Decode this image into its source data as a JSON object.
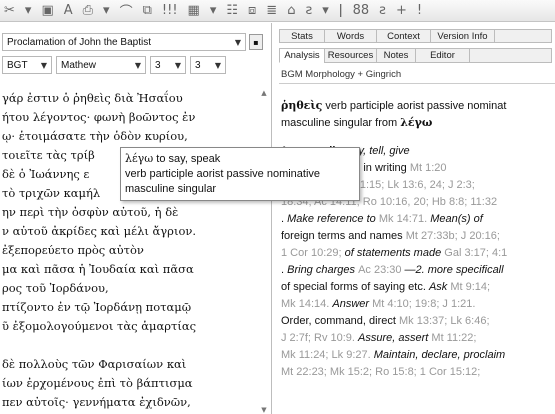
{
  "toolbar": {
    "icons": [
      "cut-icon",
      "dropdown-icon",
      "window-icon",
      "font-icon",
      "print-icon",
      "arrow-icon",
      "separator",
      "monitor-icon",
      "grid-icon",
      "columns-icon",
      "table-icon",
      "compare-icon",
      "tools-icon",
      "list-icon",
      "sep-icon",
      "plus-icon"
    ],
    "glyphs": [
      "✂",
      "▾",
      "▣",
      "A",
      "⎙",
      "▾",
      "⌒",
      "⧉",
      "!!!",
      "▦",
      "▾",
      "☷",
      "⧈",
      "≣",
      "⌂",
      "ƨ",
      "▾",
      "ǀ",
      "88",
      "ƨ",
      "+",
      "!"
    ]
  },
  "left": {
    "passage_title": "Proclamation of John the Baptist",
    "version": "BGT",
    "book": "Mathew",
    "chapter": "3",
    "verse": "3",
    "greek_lines": [
      "γάρ ἐστιν ὁ ῥηθεὶς διὰ Ἠσαΐου",
      "ήτου λέγοντος· φωνὴ βοῶντος ἐν",
      "ῳ· ἑτοιμάσατε τὴν ὁδὸν κυρίου,",
      "τοιεῖτε τὰς τρίβ",
      "δὲ ὁ Ἰωάννης ε",
      "τὸ τριχῶν καμήλ",
      "ην περὶ τὴν ὀσφὺν αὐτοῦ, ἡ δὲ",
      "ν αὐτοῦ ἀκρίδες καὶ μέλι ἄγριον.",
      "ἐξεπορεύετο πρὸς αὐτὸν",
      "μα καὶ πᾶσα ἡ Ἰουδαία καὶ πᾶσα",
      "ρος τοῦ Ἰορδάνου,",
      "πτίζοντο ἐν τῷ Ἰορδάνῃ ποταμῷ",
      "ῦ ἐξομολογούμενοι τὰς ἁμαρτίας",
      "",
      "δὲ πολλοὺς τῶν Φαρισαίων καὶ",
      "ίων ἐρχομένους ἐπὶ τὸ βάπτισμα",
      "πεν αὐτοῖς· γεννήματα ἐχιδνῶν,"
    ]
  },
  "popup": {
    "lemma": "λέγω",
    "gloss": "to say, speak",
    "parse_line1": "verb participle aorist passive nominative",
    "parse_line2": "masculine singular"
  },
  "right": {
    "tabs_row1": [
      "Stats",
      "Words",
      "Context",
      "Version Info",
      ""
    ],
    "tabs_row2": [
      "Analysis",
      "Resources",
      "Notes",
      "Editor",
      ""
    ],
    "active_tab": "Analysis",
    "resource": "BGM Morphology + Gingrich",
    "entry_word": "ῥηθεὶς",
    "entry_parse": "verb participle aorist passive nominat",
    "entry_parse2": "masculine singular from",
    "entry_lemma": "λέγω",
    "lines": [
      {
        "b": "",
        "t": "1. generally, ",
        "i": "say, tell, give",
        "r": ""
      },
      {
        "b": "",
        "t": "o orally, but also in writing ",
        "i": "",
        "r": "Mt 1:20"
      },
      {
        "b": "",
        "t": "",
        "i": "",
        "r": "9:34; 21:45; Mk 1:15; Lk 13:6, 24; J 2:3;"
      },
      {
        "b": "",
        "t": "",
        "i": "",
        "r": "18:34; Ac 14:11; Ro 10:16, 20; Hb 8:8; 11:32"
      },
      {
        "b": "",
        "t": ". ",
        "i": "Make reference to ",
        "r": "Mk 14:71. ",
        "x": "Mean(s) of"
      },
      {
        "b": "",
        "t": "foreign terms and names ",
        "i": "",
        "r": "Mt 27:33b; J 20:16;"
      },
      {
        "b": "",
        "t": "",
        "i": "",
        "r": "1 Cor 10:29; ",
        "x": "of statements made ",
        "r2": "Gal 3:17; 4:1"
      },
      {
        "b": "",
        "t": ". ",
        "i": "Bring charges ",
        "r": "Ac 23:30",
        "x": " —2. more specificall"
      },
      {
        "b": "",
        "t": "of special forms of saying etc. ",
        "i": "Ask ",
        "r": "Mt 9:14;"
      },
      {
        "b": "",
        "t": "",
        "i": "",
        "r": "Mk 14:14. ",
        "x": "Answer ",
        "r2": "Mt 4:10; 19:8; J 1:21."
      },
      {
        "b": "",
        "t": "Order, command, direct ",
        "i": "",
        "r": "Mk 13:37; Lk 6:46;"
      },
      {
        "b": "",
        "t": "",
        "i": "",
        "r": "J 2:7f; Rv 10:9. ",
        "x": "Assure, assert ",
        "r2": "Mt 11:22;"
      },
      {
        "b": "",
        "t": "",
        "i": "",
        "r": "Mk 11:24; Lk 9:27. ",
        "x": "Maintain, declare, proclaim"
      },
      {
        "b": "",
        "t": "",
        "i": "",
        "r": "Mt 22:23; Mk 15:2; Ro 15:8; 1 Cor 15:12;"
      }
    ]
  }
}
